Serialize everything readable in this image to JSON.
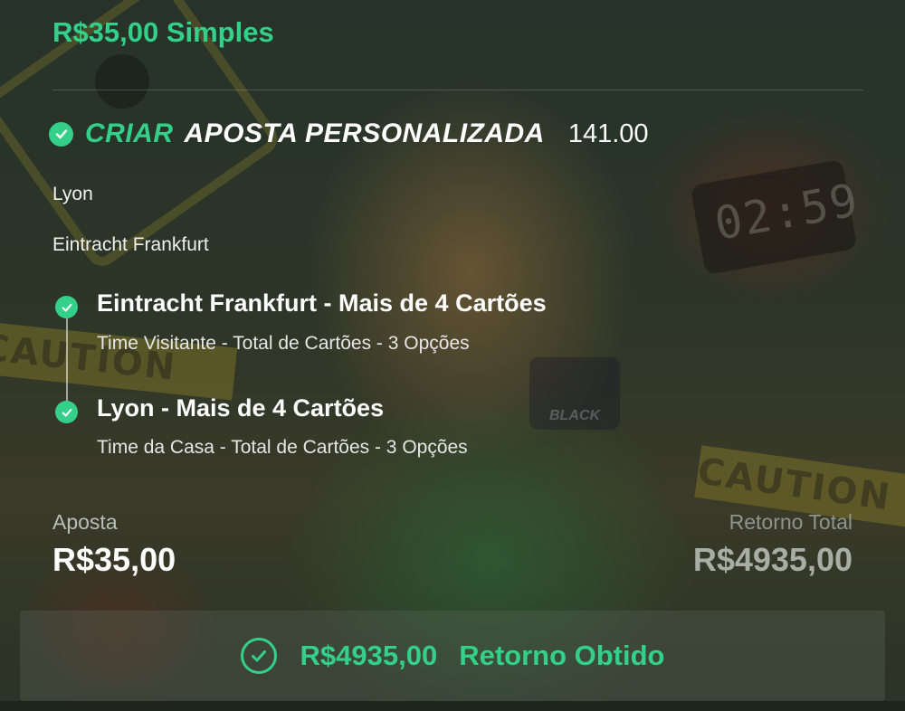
{
  "header": {
    "bet_type": "R$35,00 Simples"
  },
  "bet": {
    "title_highlight": "CRIAR",
    "title_rest": "APOSTA PERSONALIZADA",
    "odds": "141.00",
    "teams": [
      "Lyon",
      "Eintracht Frankfurt"
    ],
    "selections": [
      {
        "title": "Eintracht Frankfurt - Mais de 4 Cartões",
        "subtitle": "Time Visitante - Total de Cartões - 3 Opções"
      },
      {
        "title": "Lyon - Mais de 4 Cartões",
        "subtitle": "Time da Casa - Total de Cartões - 3 Opções"
      }
    ]
  },
  "summary": {
    "stake_label": "Aposta",
    "stake_value": "R$35,00",
    "return_label": "Retorno Total",
    "return_value": "R$4935,00"
  },
  "footer": {
    "amount": "R$4935,00",
    "label": "Retorno Obtido"
  },
  "background": {
    "tape_text": "CAUTION",
    "timer_text": "02:59",
    "logo_text": "BLACK"
  },
  "colors": {
    "accent": "#34d08a",
    "background": "#1f2b22"
  },
  "icons": [
    "check-circle-icon",
    "check-outline-icon"
  ]
}
